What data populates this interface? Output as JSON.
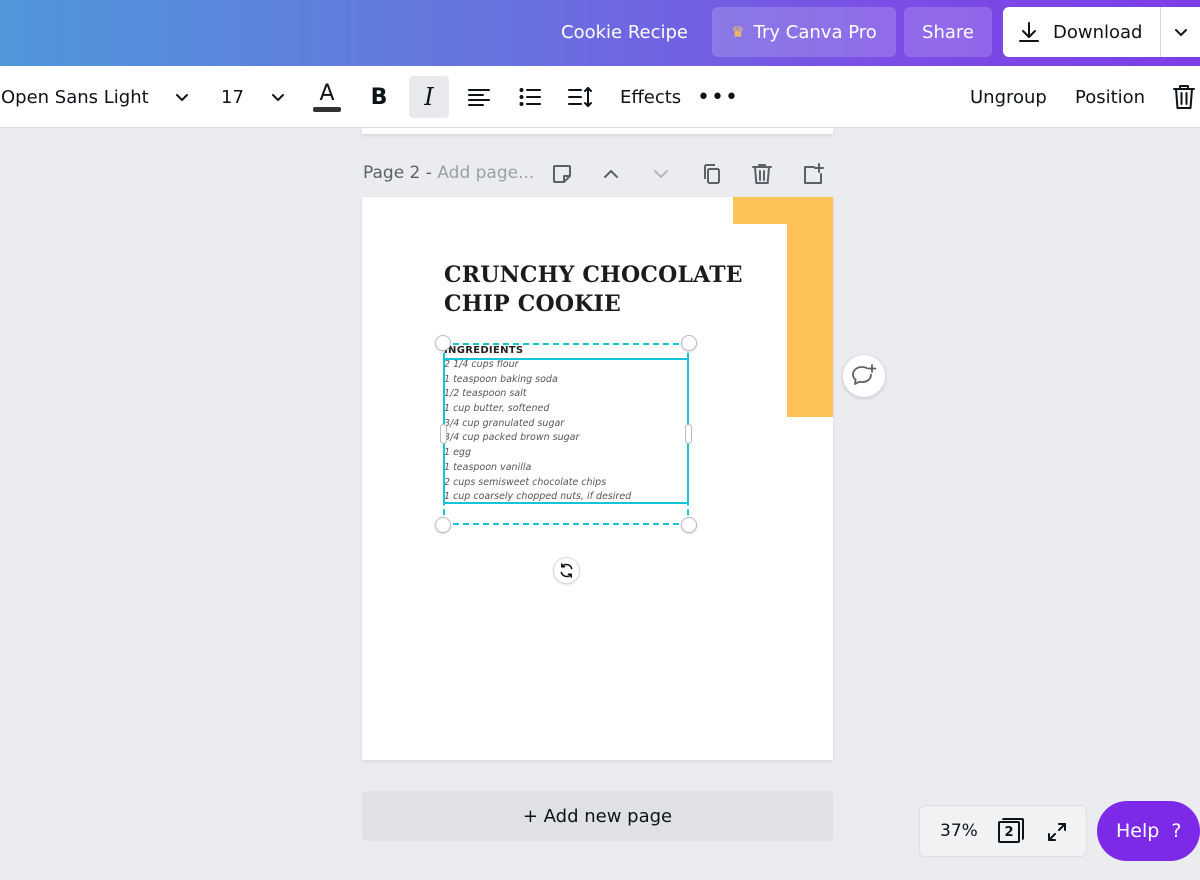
{
  "header": {
    "doc_title": "Cookie Recipe",
    "try_pro_label": "Try Canva Pro",
    "share_label": "Share",
    "download_label": "Download"
  },
  "toolbar": {
    "font_name": "Open Sans Light",
    "font_size": "17",
    "color_letter": "A",
    "bold_label": "B",
    "italic_label": "I",
    "effects_label": "Effects",
    "more_label": "•••",
    "ungroup_label": "Ungroup",
    "position_label": "Position"
  },
  "page": {
    "label": "Page 2 - ",
    "placeholder": "Add page..."
  },
  "design": {
    "title_line1": "CRUNCHY CHOCOLATE",
    "title_line2": "CHIP COOKIE",
    "ingredients_heading": "INGREDIENTS",
    "ingredients": [
      "2 1/4 cups flour",
      "1 teaspoon baking soda",
      "1/2 teaspoon salt",
      "1 cup butter, softened",
      "3/4 cup granulated sugar",
      "3/4 cup packed brown sugar",
      "1 egg",
      "1 teaspoon vanilla",
      "2 cups semisweet chocolate chips",
      "1 cup coarsely chopped nuts, if desired"
    ],
    "accent_color": "#ffc259",
    "selection_color": "#16c4d9"
  },
  "footer": {
    "add_page_label": "+ Add new page",
    "zoom": "37%",
    "page_count": "2",
    "help_label": "Help",
    "help_icon": "?"
  },
  "colors": {
    "brand_purple": "#7d2ae8",
    "header_gradient_start": "#4f97d9",
    "header_gradient_end": "#7c3ee6"
  }
}
